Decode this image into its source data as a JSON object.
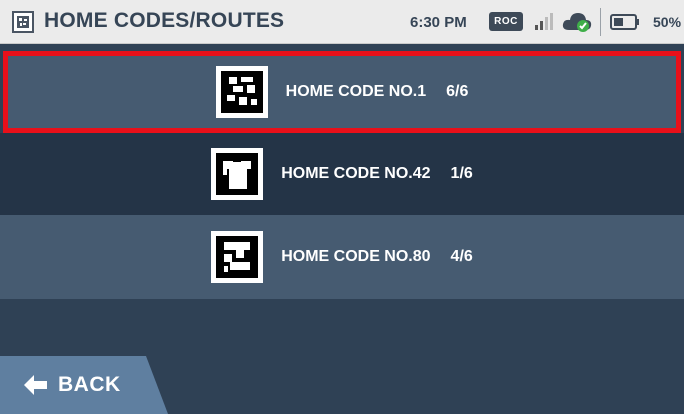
{
  "status_bar": {
    "title": "HOME CODES/ROUTES",
    "title_icon": "qr-code-icon",
    "time": "6:30 PM",
    "badge": "ROC",
    "signal_icon": "signal-icon",
    "cloud_icon": "cloud-check-icon",
    "battery_icon": "battery-icon",
    "battery_percent": "50%"
  },
  "routes": [
    {
      "label": "HOME CODE NO.1",
      "count": "6/6",
      "selected": true,
      "icon": "home-code-1-icon"
    },
    {
      "label": "HOME CODE NO.42",
      "count": "1/6",
      "selected": false,
      "icon": "home-code-42-icon"
    },
    {
      "label": "HOME CODE NO.80",
      "count": "4/6",
      "selected": false,
      "icon": "home-code-80-icon"
    }
  ],
  "back": {
    "label": "BACK",
    "icon": "arrow-left-icon"
  },
  "colors": {
    "status_bar_bg": "#ebebeb",
    "row_light": "#465b71",
    "row_dark": "#243447",
    "page_bg": "#2f4155",
    "selection_border": "#e8101a",
    "back_button": "#5f7fa0"
  }
}
